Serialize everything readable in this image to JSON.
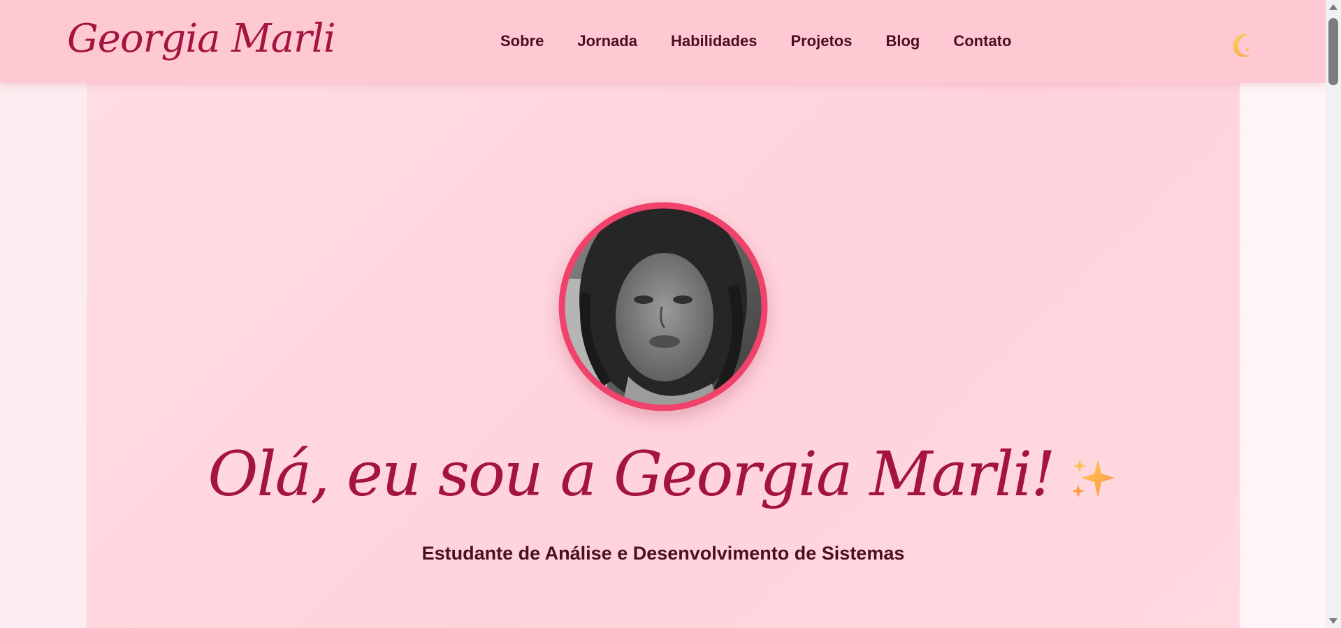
{
  "header": {
    "logo": "Georgia Marli",
    "nav": [
      {
        "label": "Sobre"
      },
      {
        "label": "Jornada"
      },
      {
        "label": "Habilidades"
      },
      {
        "label": "Projetos"
      },
      {
        "label": "Blog"
      },
      {
        "label": "Contato"
      }
    ],
    "theme_toggle_icon": "crescent-moon-icon"
  },
  "hero": {
    "title": "Olá, eu sou a Georgia Marli!",
    "title_icon": "sparkles-icon",
    "subtitle": "Estudante de Análise e Desenvolvimento de Sistemas",
    "avatar_style": "grayscale-photo"
  },
  "colors": {
    "header_bg": "#ffc9d3",
    "accent": "#a3153e",
    "nav_text": "#4a0f22",
    "avatar_border": "#f0436b",
    "hero_bg": "#ffd6de"
  }
}
